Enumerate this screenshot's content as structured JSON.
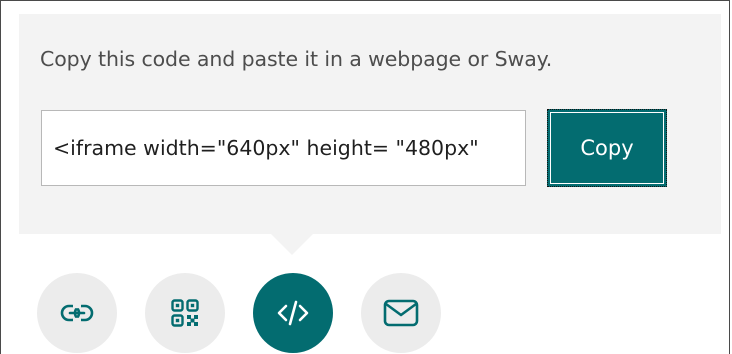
{
  "embed_dialog": {
    "instruction": "Copy this code and paste it in a webpage or Sway.",
    "embed_code_value": "<iframe width=\"640px\" height= \"480px\"",
    "copy_label": "Copy"
  },
  "share_options": {
    "items": [
      {
        "icon": "link-icon",
        "active": false
      },
      {
        "icon": "qr-code-icon",
        "active": false
      },
      {
        "icon": "embed-code-icon",
        "active": true
      },
      {
        "icon": "email-icon",
        "active": false
      }
    ]
  },
  "colors": {
    "accent": "#036c70",
    "panel_background": "#f3f3f3",
    "option_background": "#ececec",
    "icon_color": "#036c70"
  }
}
